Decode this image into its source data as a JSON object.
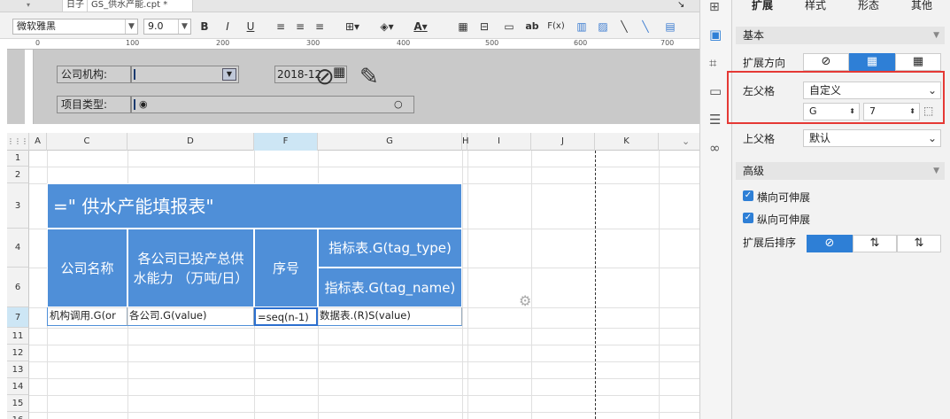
{
  "tabs": {
    "items": [
      {
        "label": "日子"
      },
      {
        "label": "GS_供水产能.cpt *"
      }
    ]
  },
  "toolbar": {
    "font": "微软雅黑",
    "size": "9.0",
    "bold": "B",
    "italic": "I",
    "underline": "U",
    "text_color": "A",
    "icons": [
      "ab",
      "F(x)"
    ]
  },
  "ruler": {
    "ticks": [
      "0",
      "100",
      "200",
      "300",
      "400",
      "500",
      "600",
      "700"
    ]
  },
  "params": {
    "company_label": "公司机构:",
    "date_value": "2018-12",
    "project_type_label": "项目类型:"
  },
  "grid": {
    "columns": [
      "A",
      "C",
      "D",
      "F",
      "G",
      "H",
      "I",
      "J",
      "K"
    ],
    "rows": [
      "1",
      "2",
      "3",
      "4",
      "6",
      "7",
      "11",
      "12",
      "13",
      "14",
      "15",
      "16"
    ],
    "title_cell": "=\"  供水产能填报表\"",
    "header": {
      "company": "公司名称",
      "capacity": "各公司已投产总供水能力 （万吨/日）",
      "seq": "序号",
      "tag_type": "指标表.G(tag_type)",
      "tag_name": "指标表.G(tag_name)"
    },
    "row7": {
      "c": "机构调用.G(or",
      "d": "各公司.G(value)",
      "f": "=seq(n-1)",
      "g": "数据表.(R)S(value)"
    }
  },
  "panel": {
    "tabs": [
      "扩展",
      "样式",
      "形态",
      "其他"
    ],
    "basic": "基本",
    "expand_direction_label": "扩展方向",
    "left_parent_label": "左父格",
    "left_parent_value": "自定义",
    "left_parent_col": "G",
    "left_parent_row": "7",
    "upper_parent_label": "上父格",
    "upper_parent_value": "默认",
    "advanced": "高级",
    "h_expand": "横向可伸展",
    "v_expand": "纵向可伸展",
    "sort_label": "扩展后排序"
  },
  "colors": {
    "accent": "#4f8fd8",
    "highlight": "#e53935",
    "checkbox": "#2e7fd6"
  }
}
